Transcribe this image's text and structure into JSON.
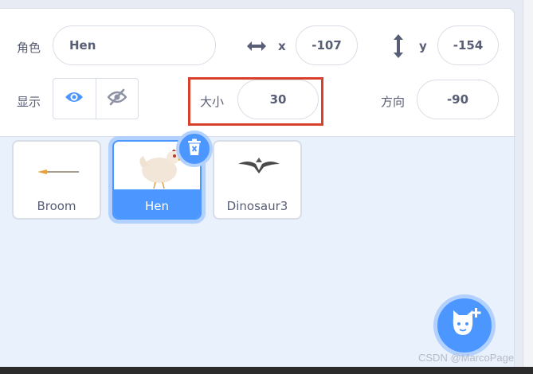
{
  "sprite_info": {
    "sprite_label": "角色",
    "sprite_name": "Hen",
    "x_label": "x",
    "x_value": "-107",
    "y_label": "y",
    "y_value": "-154",
    "show_label": "显示",
    "size_label": "大小",
    "size_value": "30",
    "direction_label": "方向",
    "direction_value": "-90"
  },
  "sprites": [
    {
      "name": "Broom",
      "selected": false,
      "icon": "broom-icon"
    },
    {
      "name": "Hen",
      "selected": true,
      "icon": "hen-icon"
    },
    {
      "name": "Dinosaur3",
      "selected": false,
      "icon": "dinosaur-icon"
    }
  ],
  "icons": {
    "x_axis": "horizontal-arrows-icon",
    "y_axis": "vertical-arrows-icon",
    "show": "eye-icon",
    "hide": "eye-off-icon",
    "delete": "trash-icon",
    "add_sprite": "cat-plus-icon"
  },
  "colors": {
    "accent": "#4c97ff",
    "highlight_box": "#d9402b",
    "text": "#575e75",
    "panel_bg": "#e9f1fc"
  },
  "watermark": "CSDN @MarcoPage"
}
